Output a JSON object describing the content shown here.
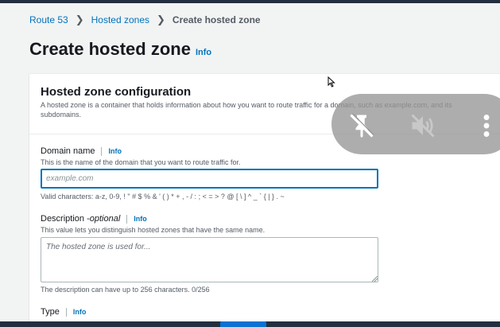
{
  "breadcrumb": {
    "items": [
      "Route 53",
      "Hosted zones"
    ],
    "current": "Create hosted zone"
  },
  "page": {
    "title": "Create hosted zone",
    "info": "Info"
  },
  "config": {
    "title": "Hosted zone configuration",
    "description": "A hosted zone is a container that holds information about how you want to route traffic for a domain, such as example.com, and its subdomains."
  },
  "domain": {
    "label": "Domain name",
    "info": "Info",
    "help": "This is the name of the domain that you want to route traffic for.",
    "placeholder": "example.com",
    "value": "",
    "constraint": "Valid characters: a-z, 0-9, ! \" # $ % & ' ( ) * + , - / : ; < = > ? @ [ \\ ] ^ _ ` { | } . ~"
  },
  "description_field": {
    "label": "Description - ",
    "optional": "optional",
    "info": "Info",
    "help": "This value lets you distinguish hosted zones that have the same name.",
    "placeholder": "The hosted zone is used for...",
    "constraint": "The description can have up to 256 characters. 0/256"
  },
  "type_field": {
    "label": "Type",
    "info": "Info"
  },
  "overlay": {
    "icons": [
      "pin-off-icon",
      "volume-off-icon",
      "more-vertical-icon"
    ]
  }
}
